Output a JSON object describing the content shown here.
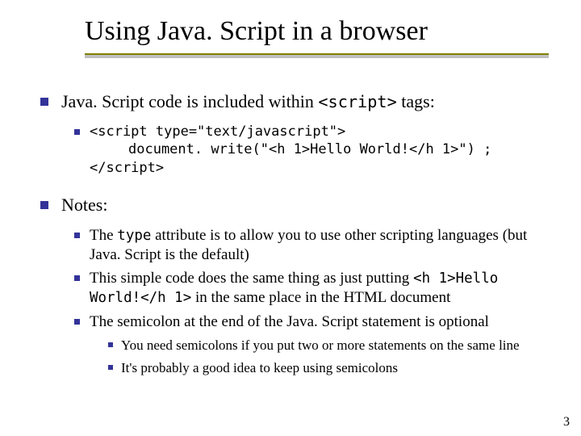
{
  "title": "Using Java. Script in a browser",
  "bullets": {
    "b1_pre": "Java. Script code is included within ",
    "b1_code": "<script>",
    "b1_post": " tags:",
    "code_line1": "<script type=\"text/javascript\">",
    "code_line2": "document. write(\"<h 1>Hello World!</h 1>\") ;",
    "code_line3": "</script>",
    "b2": "Notes:",
    "n1_pre": "The ",
    "n1_code": "type",
    "n1_post": " attribute is to allow you to use other scripting languages (but Java. Script is the default)",
    "n2_pre": "This simple code does the same thing as just putting ",
    "n2_code": "<h 1>Hello World!</h 1>",
    "n2_post": " in the same place in the HTML document",
    "n3": "The semicolon at the end of the Java. Script statement is optional",
    "s1": "You need semicolons if you put two or more statements on the same line",
    "s2": "It's probably a good idea to keep using semicolons"
  },
  "page_number": "3"
}
